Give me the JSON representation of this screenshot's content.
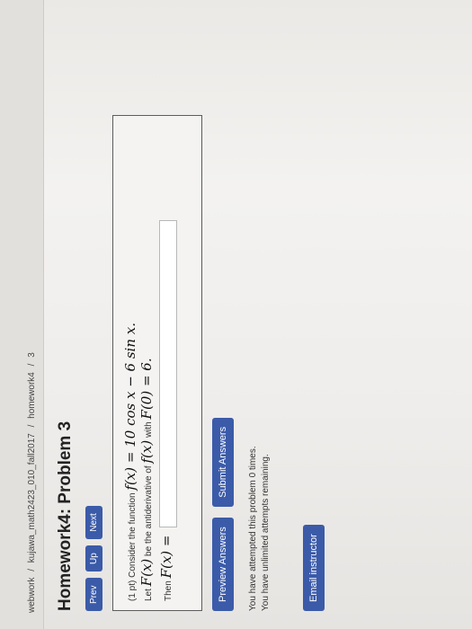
{
  "breadcrumb": {
    "items": [
      "webwork",
      "/",
      "kujawa_math2423_010_fall2017",
      "/",
      "homework4",
      "/",
      "3"
    ]
  },
  "page": {
    "title": "Homework4: Problem 3"
  },
  "nav": {
    "prev": "Prev",
    "up": "Up",
    "next": "Next"
  },
  "problem": {
    "prefix": "(1 pt) Consider the function",
    "function_expr": "f(x) = 10 cos x − 6 sin x.",
    "line2_prefix": "Let",
    "line2_symbol": "F(x)",
    "line2_mid": "be the antiderivative of",
    "line2_symbol2": "f(x)",
    "line2_suffix": "with",
    "line2_condition": "F(0) = 6.",
    "line3_prefix": "Then",
    "line3_symbol": "F(x) ="
  },
  "actions": {
    "preview": "Preview Answers",
    "submit": "Submit Answers"
  },
  "status": {
    "line1": "You have attempted this problem 0 times.",
    "line2": "You have unlimited attempts remaining."
  },
  "buttons": {
    "email": "Email instructor"
  }
}
